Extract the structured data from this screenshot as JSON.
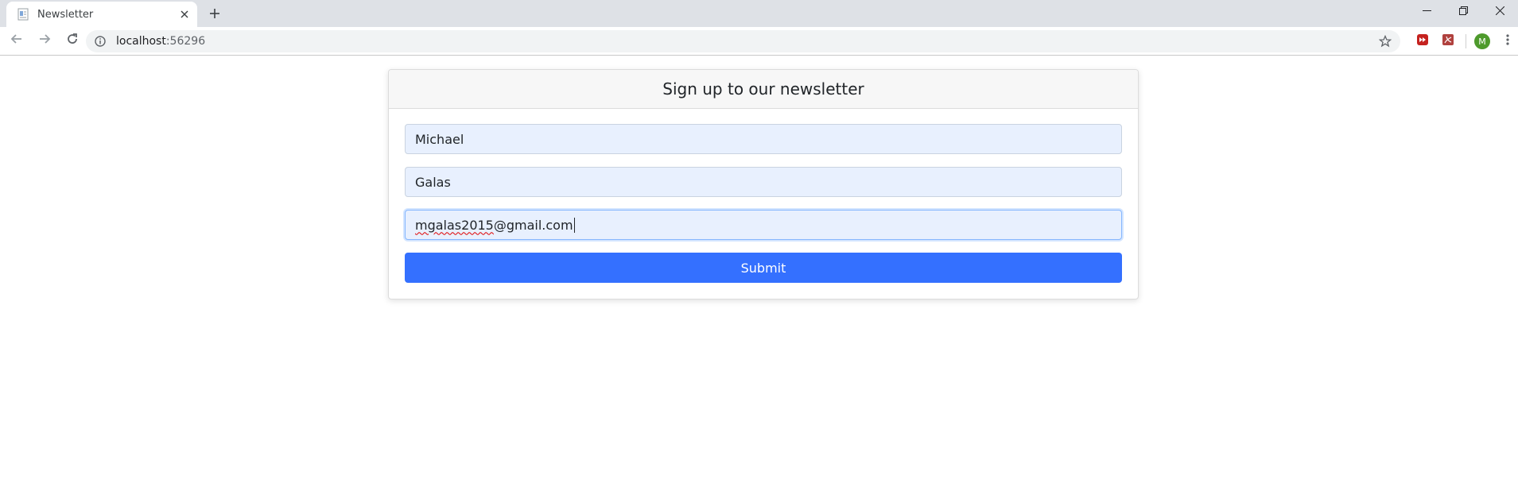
{
  "browser": {
    "tab": {
      "title": "Newsletter"
    },
    "address": {
      "host": "localhost",
      "port": ":56296"
    },
    "profile_initial": "M"
  },
  "form": {
    "title": "Sign up to our newsletter",
    "first_name": "Michael",
    "last_name": "Galas",
    "email_user": "mgalas2015",
    "email_domain": "@gmail.com",
    "submit_label": "Submit"
  },
  "colors": {
    "primary_button": "#3470ff",
    "field_bg": "#e8f0fe",
    "tab_strip": "#dee1e6",
    "avatar": "#4e9a2c"
  },
  "icons": {
    "tab_favicon": "document-icon",
    "tab_close": "close-icon",
    "new_tab": "plus-icon",
    "back": "back-arrow-icon",
    "forward": "forward-arrow-icon",
    "reload": "reload-icon",
    "site_info": "info-icon",
    "bookmark": "star-icon",
    "ext1": "media-extension-icon",
    "ext2": "pdf-extension-icon",
    "menu": "kebab-menu-icon"
  }
}
